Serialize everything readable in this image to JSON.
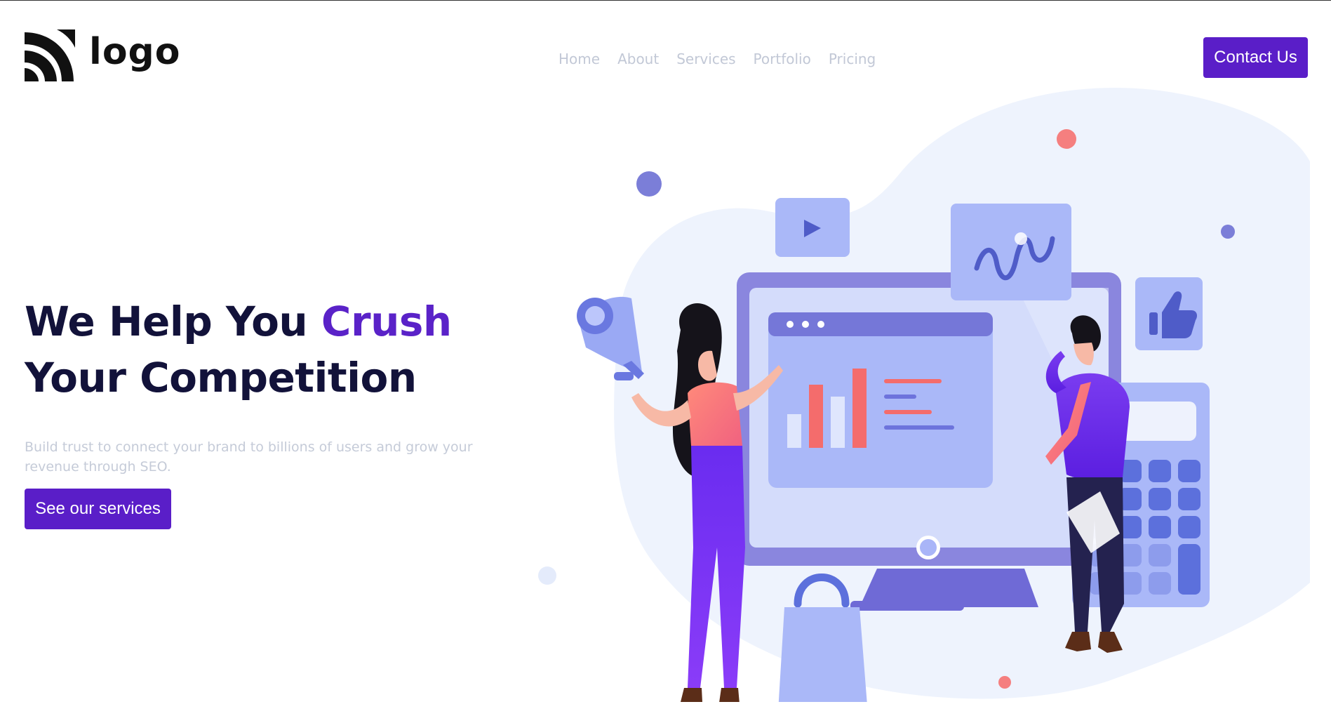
{
  "header": {
    "logo_text": "logo",
    "nav": [
      "Home",
      "About",
      "Services",
      "Portfolio",
      "Pricing"
    ],
    "contact_label": "Contact Us"
  },
  "hero": {
    "title_part1": "We Help You ",
    "title_accent": "Crush",
    "title_part2": " Your Competition",
    "subtitle": "Build trust to connect your brand to billions of users and grow your revenue through SEO.",
    "cta_label": "See our services"
  },
  "colors": {
    "primary": "#5a1ec8",
    "heading": "#12123a",
    "muted": "#c5cbd8"
  },
  "illustration": {
    "icons": [
      "play-icon",
      "chart-wave-icon",
      "thumbs-up-icon",
      "megaphone-icon",
      "calculator-icon",
      "shopping-bag-icon",
      "monitor-icon"
    ]
  }
}
